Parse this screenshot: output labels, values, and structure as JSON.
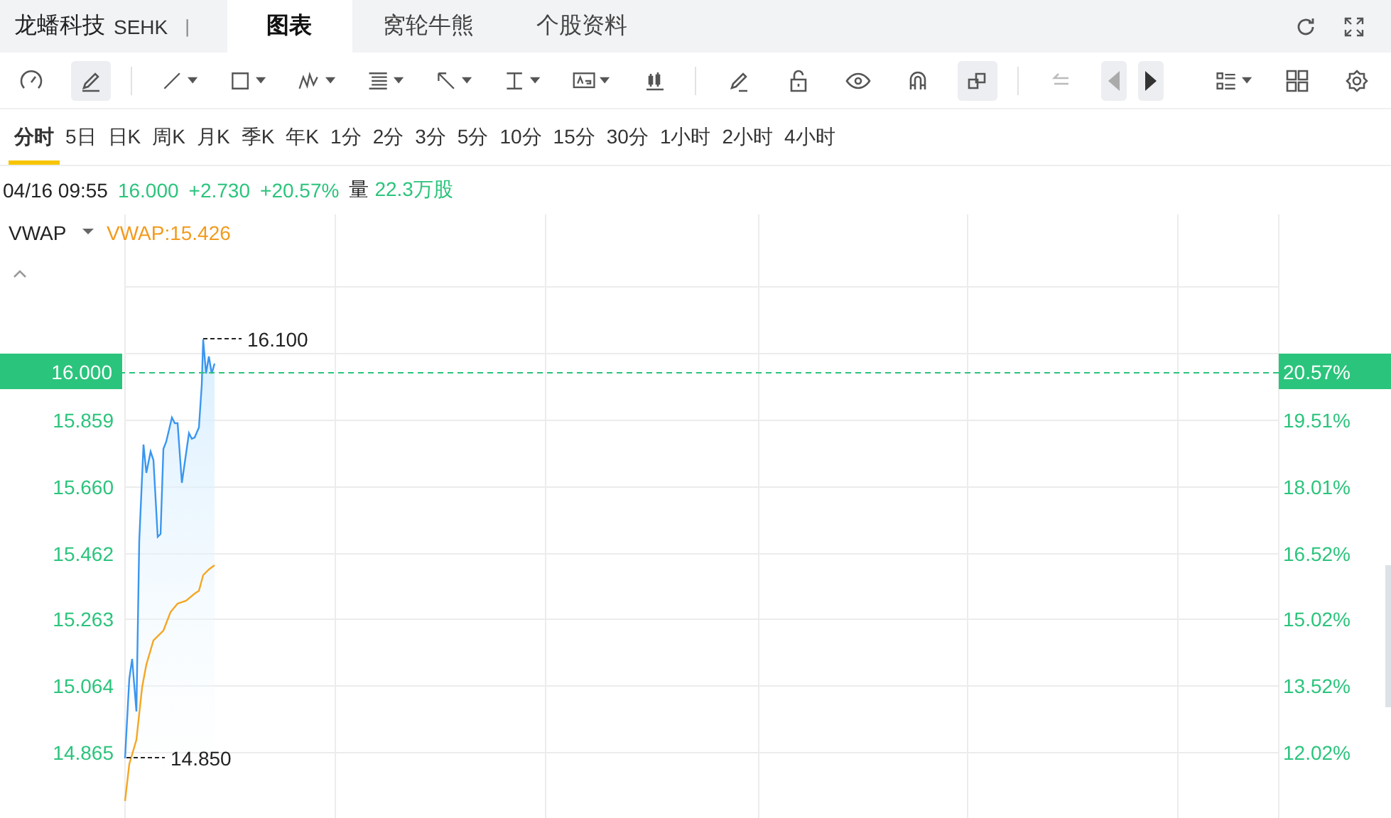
{
  "header": {
    "title": "龙蟠科技",
    "exchange": "SEHK",
    "separator": "|",
    "tabs": [
      {
        "label": "图表",
        "selected": true
      },
      {
        "label": "窝轮牛熊",
        "selected": false
      },
      {
        "label": "个股资料",
        "selected": false
      }
    ]
  },
  "toolbar": {
    "tools": [
      {
        "kind": "gauge",
        "active": false,
        "disabled": false,
        "menu": false
      },
      {
        "kind": "pen",
        "active": true,
        "disabled": false,
        "menu": false
      },
      {
        "kind": "line",
        "active": false,
        "disabled": false,
        "menu": true
      },
      {
        "kind": "rect",
        "active": false,
        "disabled": false,
        "menu": true
      },
      {
        "kind": "pattern",
        "active": false,
        "disabled": false,
        "menu": true
      },
      {
        "kind": "fib",
        "active": false,
        "disabled": false,
        "menu": true
      },
      {
        "kind": "arrow",
        "active": false,
        "disabled": false,
        "menu": true
      },
      {
        "kind": "measure",
        "active": false,
        "disabled": false,
        "menu": true
      },
      {
        "kind": "text",
        "active": false,
        "disabled": false,
        "menu": true
      },
      {
        "kind": "candles",
        "active": false,
        "disabled": false,
        "menu": false
      },
      {
        "kind": "eraser",
        "active": false,
        "disabled": false,
        "menu": false
      },
      {
        "kind": "lock",
        "active": false,
        "disabled": false,
        "menu": false
      },
      {
        "kind": "eye",
        "active": false,
        "disabled": false,
        "menu": false
      },
      {
        "kind": "magnet",
        "active": false,
        "disabled": false,
        "menu": false
      },
      {
        "kind": "link",
        "active": true,
        "disabled": false,
        "menu": false
      },
      {
        "kind": "back",
        "active": false,
        "disabled": true,
        "menu": false
      },
      {
        "kind": "prev",
        "active": true,
        "disabled": true,
        "menu": false
      },
      {
        "kind": "next",
        "active": true,
        "disabled": false,
        "menu": false
      },
      {
        "kind": "list",
        "active": false,
        "disabled": false,
        "menu": true
      },
      {
        "kind": "grid",
        "active": false,
        "disabled": false,
        "menu": false
      },
      {
        "kind": "gear",
        "active": false,
        "disabled": false,
        "menu": false
      }
    ]
  },
  "periods": [
    {
      "label": "分时",
      "selected": true
    },
    {
      "label": "5日",
      "selected": false
    },
    {
      "label": "日K",
      "selected": false
    },
    {
      "label": "周K",
      "selected": false
    },
    {
      "label": "月K",
      "selected": false
    },
    {
      "label": "季K",
      "selected": false
    },
    {
      "label": "年K",
      "selected": false
    },
    {
      "label": "1分",
      "selected": false
    },
    {
      "label": "2分",
      "selected": false
    },
    {
      "label": "3分",
      "selected": false
    },
    {
      "label": "5分",
      "selected": false
    },
    {
      "label": "10分",
      "selected": false
    },
    {
      "label": "15分",
      "selected": false
    },
    {
      "label": "30分",
      "selected": false
    },
    {
      "label": "1小时",
      "selected": false
    },
    {
      "label": "2小时",
      "selected": false
    },
    {
      "label": "4小时",
      "selected": false
    }
  ],
  "quote": {
    "time": "04/16 09:55",
    "price": "16.000",
    "change": "+2.730",
    "change_pct": "+20.57%",
    "volume_label": "量",
    "volume": "22.3万股"
  },
  "indicator": {
    "name": "VWAP",
    "value": "VWAP:15.426"
  },
  "chart": {
    "price_labels": [
      "15.859",
      "15.660",
      "15.462",
      "15.263",
      "15.064",
      "14.865"
    ],
    "pct_labels": [
      "19.51%",
      "18.01%",
      "16.52%",
      "15.02%",
      "13.52%",
      "12.02%"
    ],
    "current_price": "16.000",
    "current_pct": "20.57%",
    "high_label": "16.100",
    "low_label": "14.850"
  }
}
